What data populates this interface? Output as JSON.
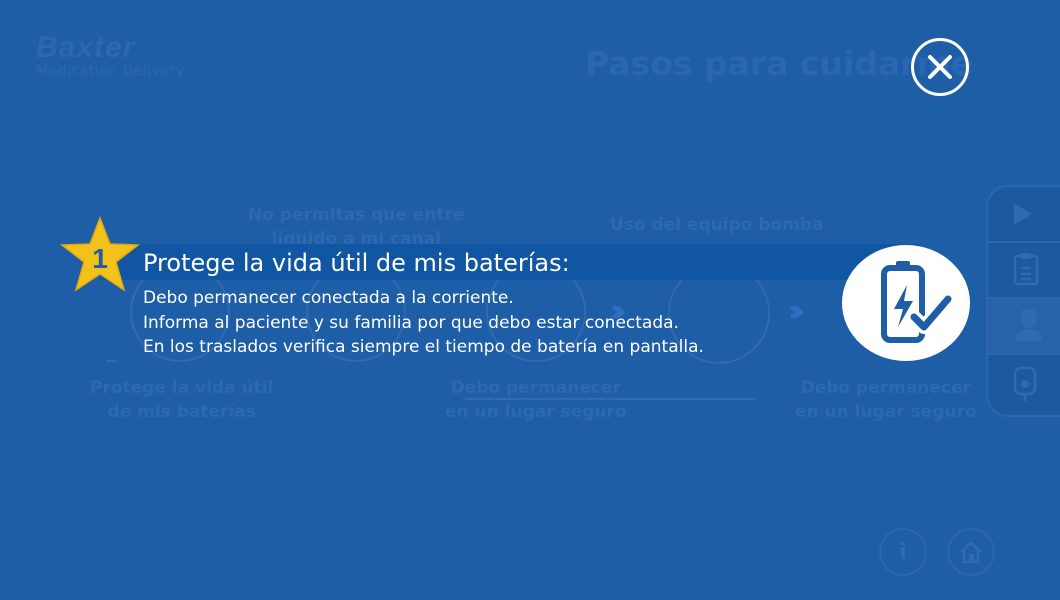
{
  "brand": {
    "name": "Baxter",
    "subtitle": "Medication Delivery"
  },
  "background": {
    "title": "Pasos para cuidarme",
    "labels": [
      {
        "l1": "No permitas que entre",
        "l2": "líquido a mi canal"
      },
      {
        "l1": "Uso del equipo bomba",
        "l2": ""
      },
      {
        "l1": "Protege la vida útil",
        "l2": "de mis baterías"
      },
      {
        "l1": "Debo permanecer",
        "l2": "en un lugar seguro"
      },
      {
        "l1": "Debo permanecer",
        "l2": "en un lugar seguro"
      }
    ]
  },
  "popup": {
    "step_number": "1",
    "title": "Protege la vida útil de mis baterías:",
    "lines": [
      "Debo permanecer conectada a la corriente.",
      "Informa al paciente y su familia por que debo estar conectada.",
      "En los traslados verifica siempre el tiempo de batería en pantalla."
    ],
    "icon": "battery-check-icon"
  },
  "side_menu": {
    "items": [
      "play-icon",
      "clipboard-icon",
      "nurse-icon",
      "iv-bag-icon"
    ],
    "active_index": 2
  },
  "bottom": {
    "info_label": "i",
    "home_icon": "home-icon"
  },
  "colors": {
    "background": "#1d5ea6",
    "band": "#1156a2",
    "star": "#f3c21a",
    "text": "#ffffff"
  }
}
